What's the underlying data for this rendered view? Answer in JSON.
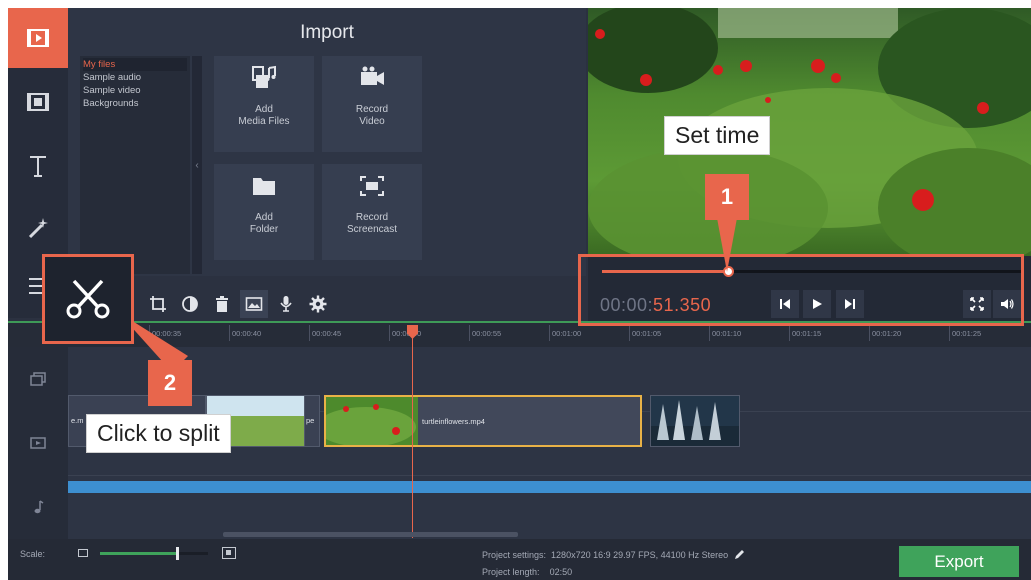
{
  "sidebar": {
    "items": [
      {
        "name": "import",
        "icon": "film-import-icon",
        "active": true
      },
      {
        "name": "filters",
        "icon": "film-filter-icon",
        "active": false
      },
      {
        "name": "titles",
        "icon": "titles-icon",
        "active": false
      },
      {
        "name": "transitions",
        "icon": "magic-wand-icon",
        "active": false
      },
      {
        "name": "more",
        "icon": "menu-icon",
        "active": false
      }
    ]
  },
  "import_panel": {
    "title": "Import",
    "files": [
      "My files",
      "Sample audio",
      "Sample video",
      "Backgrounds"
    ],
    "selected_file": "My files",
    "tiles": [
      {
        "line1": "Add",
        "line2": "Media Files",
        "icon": "media-files-icon"
      },
      {
        "line1": "Record",
        "line2": "Video",
        "icon": "video-camera-icon"
      },
      {
        "line1": "Add",
        "line2": "Folder",
        "icon": "folder-icon"
      },
      {
        "line1": "Record",
        "line2": "Screencast",
        "icon": "screencast-icon"
      }
    ]
  },
  "player": {
    "progress": 0.3,
    "timecode_dim": "00:00:",
    "timecode_hi": "51.350"
  },
  "timeline": {
    "ruler_ticks": [
      "00:00:35",
      "00:00:40",
      "00:00:45",
      "00:00:50",
      "00:00:55",
      "00:01:00",
      "00:01:05",
      "00:01:10",
      "00:01:15",
      "00:01:20",
      "00:01:25"
    ],
    "clips": {
      "first": "e.m",
      "second": "pe",
      "selected": "turtleinflowers.mp4"
    }
  },
  "status": {
    "scale_label": "Scale:",
    "zoom_level": 0.7,
    "settings_label": "Project settings:",
    "settings_value": "1280x720 16:9 29.97 FPS, 44100 Hz Stereo",
    "length_label": "Project length:",
    "length_value": "02:50",
    "export_label": "Export"
  },
  "callouts": {
    "one": {
      "number": "1",
      "text": "Set time"
    },
    "two": {
      "number": "2",
      "text": "Click to split"
    }
  },
  "colors": {
    "accent": "#e8664c",
    "export": "#3fa35b",
    "audio": "#3d8fd0",
    "selected_clip": "#e9b247"
  }
}
